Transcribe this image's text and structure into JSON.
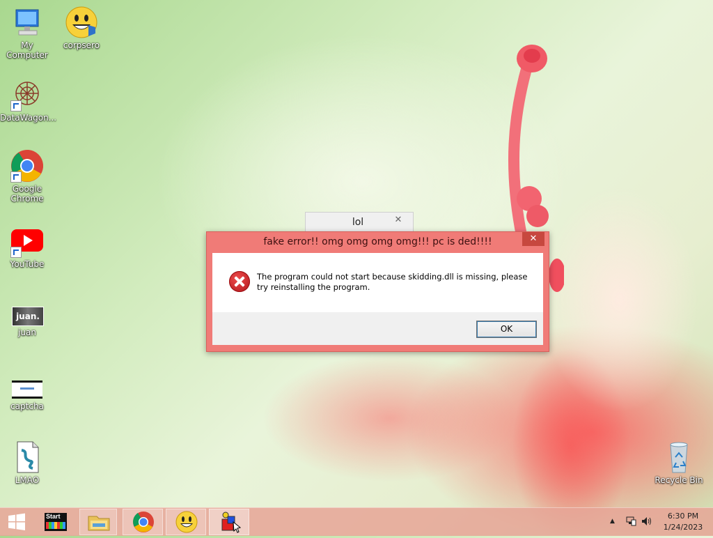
{
  "desktop": {
    "icons": [
      {
        "label": "My Computer",
        "icon": "computer-icon"
      },
      {
        "label": "corpsero",
        "icon": "smiley-icon"
      },
      {
        "label": "DataWagon...",
        "icon": "datawagon-icon"
      },
      {
        "label": "Google Chrome",
        "icon": "chrome-icon"
      },
      {
        "label": "YouTube",
        "icon": "youtube-icon"
      },
      {
        "label": "juan",
        "icon": "juan-image-icon",
        "image_text": "juan."
      },
      {
        "label": "captcha",
        "icon": "captcha-image-icon"
      },
      {
        "label": "LMAO",
        "icon": "script-file-icon"
      },
      {
        "label": "Recycle Bin",
        "icon": "recycle-bin-icon"
      }
    ]
  },
  "background_window": {
    "title": "lol",
    "close": "✕"
  },
  "dialog": {
    "title": "fake error!! omg omg omg omg!!! pc is ded!!!!",
    "close": "✕",
    "message": "The program could not start because skidding.dll is missing, please try reinstalling the program.",
    "ok_label": "OK",
    "icon": "error-icon"
  },
  "taskbar": {
    "start_label": "Start",
    "items": [
      "windows-logo-icon",
      "start-app-icon",
      "file-explorer-icon",
      "chrome-icon",
      "smiley-icon",
      "app-shapes-icon"
    ],
    "time": "6:30 PM",
    "date": "1/24/2023"
  },
  "colors": {
    "dialog_frame": "#f07b77",
    "close_button": "#c7483f",
    "taskbar": "#e6a596"
  }
}
